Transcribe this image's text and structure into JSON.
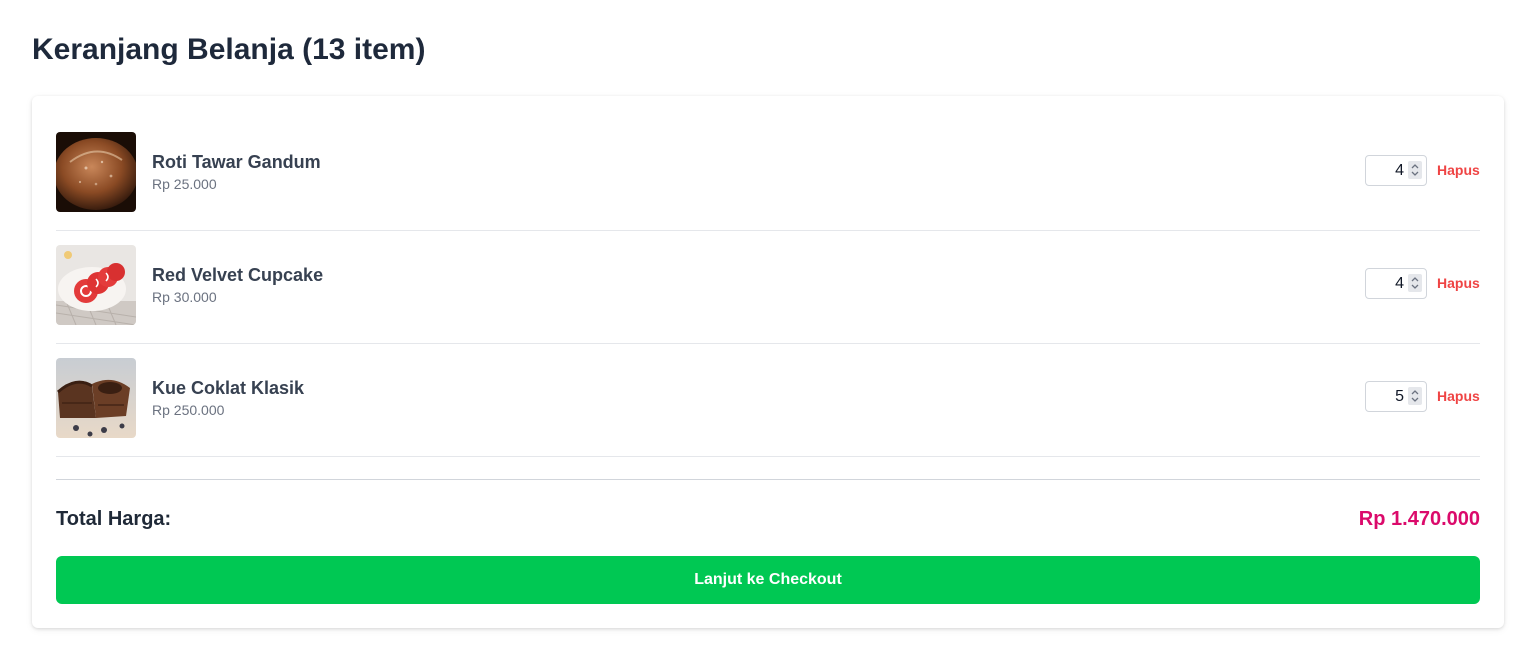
{
  "page": {
    "title": "Keranjang Belanja (13 item)"
  },
  "cart": {
    "items": [
      {
        "name": "Roti Tawar Gandum",
        "price": "Rp 25.000",
        "quantity": "4",
        "remove_label": "Hapus",
        "image_icon": "bread-image"
      },
      {
        "name": "Red Velvet Cupcake",
        "price": "Rp 30.000",
        "quantity": "4",
        "remove_label": "Hapus",
        "image_icon": "red-velvet-roll-image"
      },
      {
        "name": "Kue Coklat Klasik",
        "price": "Rp 250.000",
        "quantity": "5",
        "remove_label": "Hapus",
        "image_icon": "chocolate-cake-image"
      }
    ],
    "total_label": "Total Harga:",
    "total_value": "Rp 1.470.000",
    "checkout_label": "Lanjut ke Checkout"
  },
  "colors": {
    "remove": "#ef4444",
    "total": "#db0a6b",
    "checkout": "#00c853"
  }
}
